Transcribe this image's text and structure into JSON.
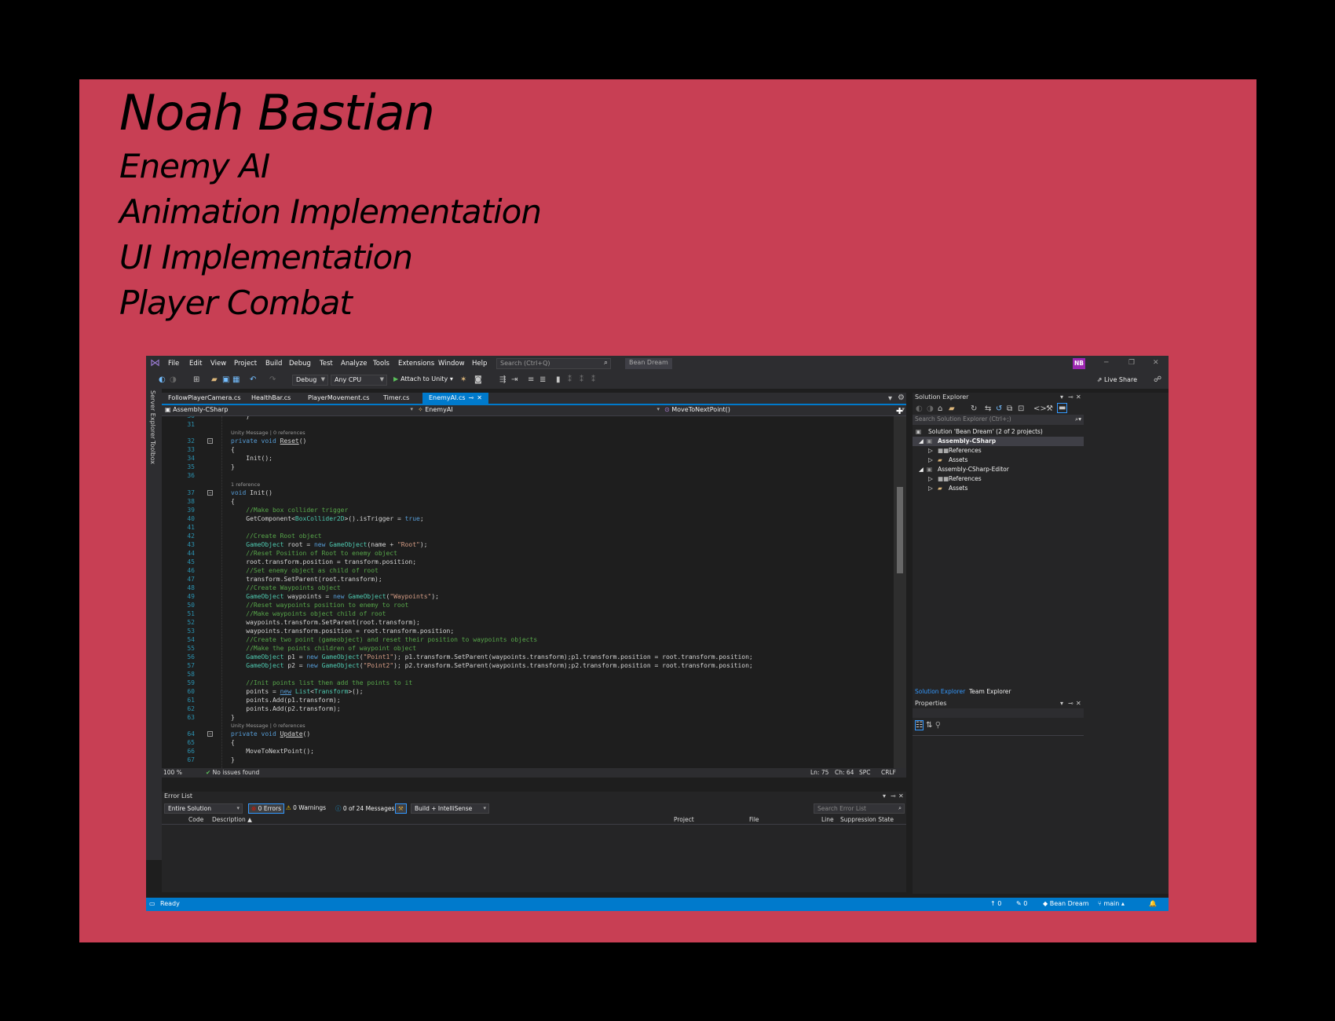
{
  "slide": {
    "title": "Noah Bastian",
    "items": [
      "Enemy AI",
      "Animation Implementation",
      "UI Implementation",
      "Player Combat"
    ]
  },
  "vs": {
    "menu": [
      "File",
      "Edit",
      "View",
      "Project",
      "Build",
      "Debug",
      "Test",
      "Analyze",
      "Tools",
      "Extensions",
      "Window",
      "Help"
    ],
    "search_placeholder": "Search (Ctrl+Q)",
    "solution_name": "Bean Dream",
    "user_initials": "NB",
    "toolbar": {
      "config": "Debug",
      "platform": "Any CPU",
      "attach": "Attach to Unity",
      "live_share": "Live Share"
    },
    "side_tabs": [
      "Server Explorer",
      "Toolbox"
    ],
    "tabs": [
      "FollowPlayerCamera.cs",
      "HealthBar.cs",
      "PlayerMovement.cs",
      "Timer.cs",
      "EnemyAI.cs"
    ],
    "active_tab": "EnemyAI.cs",
    "nav": {
      "project": "Assembly-CSharp",
      "class": "EnemyAI",
      "member": "MoveToNextPoint()"
    },
    "code": {
      "lens_unity": "Unity Message | 0 references",
      "lens_1ref": "1 reference"
    },
    "editor_status": {
      "zoom": "100 %",
      "issues": "No issues found",
      "ln": "Ln: 75",
      "ch": "Ch: 64",
      "spc": "SPC",
      "crlf": "CRLF"
    },
    "error_list": {
      "title": "Error List",
      "scope": "Entire Solution",
      "errors": "0 Errors",
      "warnings": "0 Warnings",
      "messages": "0 of 24 Messages",
      "build": "Build + IntelliSense",
      "search": "Search Error List",
      "columns": [
        "Code",
        "Description",
        "Project",
        "File",
        "Line",
        "Suppression State"
      ]
    },
    "solution_explorer": {
      "title": "Solution Explorer",
      "search": "Search Solution Explorer (Ctrl+;)",
      "solution": "Solution 'Bean Dream' (2 of 2 projects)",
      "project1": "Assembly-CSharp",
      "project2": "Assembly-CSharp-Editor",
      "references": "References",
      "assets": "Assets",
      "tab1": "Solution Explorer",
      "tab2": "Team Explorer"
    },
    "properties_title": "Properties",
    "status": {
      "ready": "Ready",
      "up": "0",
      "pencil": "0",
      "repo": "Bean Dream",
      "branch": "main"
    }
  }
}
